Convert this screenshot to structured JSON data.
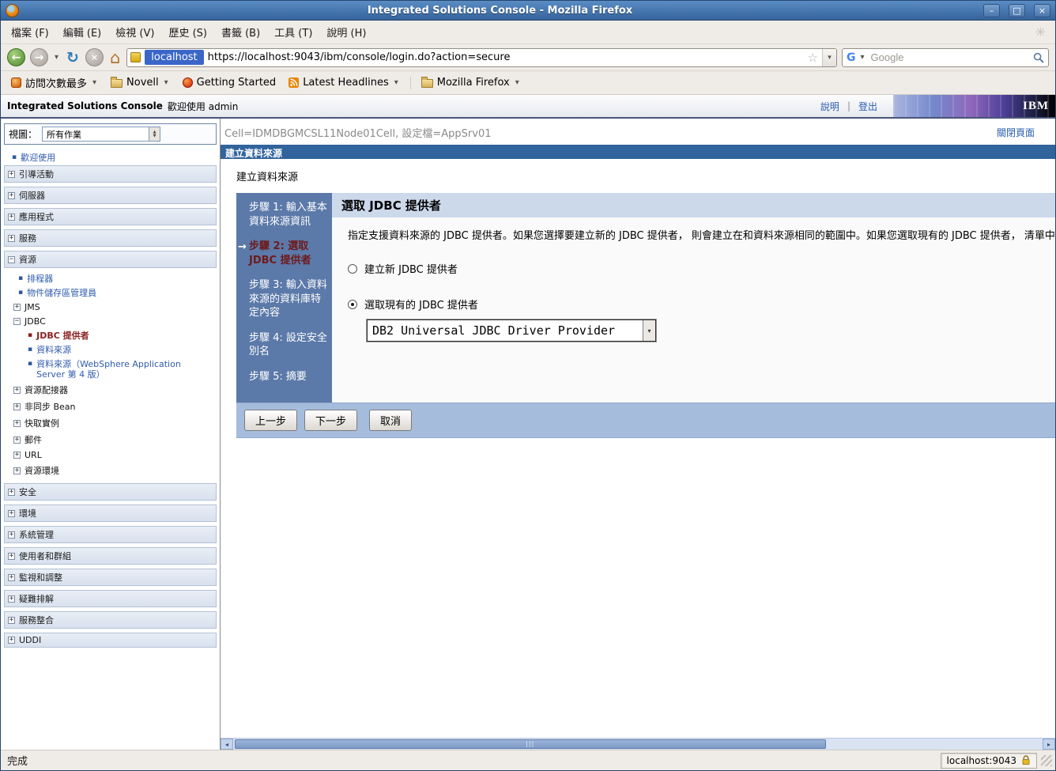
{
  "window": {
    "title": "Integrated Solutions Console - Mozilla Firefox"
  },
  "icons": {
    "minimize": "–",
    "maximize": "□",
    "close": "×",
    "back_arrow": "←",
    "forward_arrow": "→",
    "dropdown_chevron": "▾",
    "reload": "↻",
    "stop": "×",
    "home": "⌂",
    "star": "☆",
    "throbber": "✳",
    "expand": "+",
    "collapse": "−",
    "bullet": "▪",
    "current_step_arrow": "→",
    "scroll_left": "◂",
    "scroll_right": "▸",
    "spin_up": "▲",
    "spin_down": "▼",
    "google_g": "G",
    "grip": "|||",
    "link_sep": "|"
  },
  "menubar": {
    "items": [
      "檔案 (F)",
      "編輯 (E)",
      "檢視 (V)",
      "歷史 (S)",
      "書籤 (B)",
      "工具 (T)",
      "說明 (H)"
    ]
  },
  "navbar": {
    "url_domain": "localhost",
    "url": "https://localhost:9043/ibm/console/login.do?action=secure",
    "search_placeholder": "Google"
  },
  "bookmarks_bar": {
    "items": [
      "訪問次數最多",
      "Novell",
      "Getting Started",
      "Latest Headlines",
      "Mozilla Firefox"
    ]
  },
  "banner": {
    "title": "Integrated Solutions Console",
    "welcome": "歡迎使用",
    "user": "admin",
    "help": "說明",
    "logout": "登出",
    "logo": "IBM"
  },
  "sidebar": {
    "view_label": "視圖：",
    "view_value": "所有作業",
    "welcome": "歡迎使用",
    "cat_guided": "引導活動",
    "cat_servers": "伺服器",
    "cat_applications": "應用程式",
    "cat_services": "服務",
    "cat_resources": "資源",
    "res_schedulers": "排程器",
    "res_object_pool": "物件儲存區管理員",
    "res_jms": "JMS",
    "res_jdbc": "JDBC",
    "jdbc_providers": "JDBC 提供者",
    "jdbc_data_sources": "資料來源",
    "jdbc_data_sources_v4": "資料來源（WebSphere Application Server 第 4 版）",
    "res_adapters": "資源配接器",
    "res_async_beans": "非同步 Bean",
    "res_cache": "快取實例",
    "res_mail": "郵件",
    "res_url": "URL",
    "res_env": "資源環境",
    "cat_security": "安全",
    "cat_environment": "環境",
    "cat_sysadmin": "系統管理",
    "cat_users": "使用者和群組",
    "cat_monitoring": "監視和調整",
    "cat_troubleshooting": "疑難排解",
    "cat_service_integration": "服務整合",
    "cat_uddi": "UDDI"
  },
  "main": {
    "context": "Cell=IDMDBGMCSL11Node01Cell, 設定檔=AppSrv01",
    "close_page": "關閉頁面",
    "panel_bar": "建立資料來源",
    "wizard_title": "建立資料來源",
    "steps": [
      {
        "label": "步驟 1: 輸入基本資料來源資訊"
      },
      {
        "label": "步驟 2: 選取 JDBC 提供者"
      },
      {
        "label": "步驟 3: 輸入資料來源的資料庫特定內容"
      },
      {
        "label": "步驟 4: 設定安全別名"
      },
      {
        "label": "步驟 5: 摘要"
      }
    ],
    "step_title": "選取 JDBC 提供者",
    "description": "指定支援資料來源的 JDBC 提供者。如果您選擇要建立新的 JDBC 提供者， 則會建立在和資料來源相同的範圍中。如果您選取現有的 JDBC 提供者， 清單中只會提供現行",
    "radio_new": "建立新 JDBC 提供者",
    "radio_existing": "選取現有的 JDBC 提供者",
    "provider_value": "DB2 Universal JDBC Driver Provider",
    "buttons": {
      "previous": "上一步",
      "next": "下一步",
      "cancel": "取消"
    }
  },
  "statusbar": {
    "status": "完成",
    "security_host": "localhost:9043"
  },
  "colors": {
    "panel_bar_blue": "#31639c",
    "steps_blue": "#5b79a9",
    "current_step_red": "#6e1a1a",
    "link_blue": "#2a5db0"
  }
}
